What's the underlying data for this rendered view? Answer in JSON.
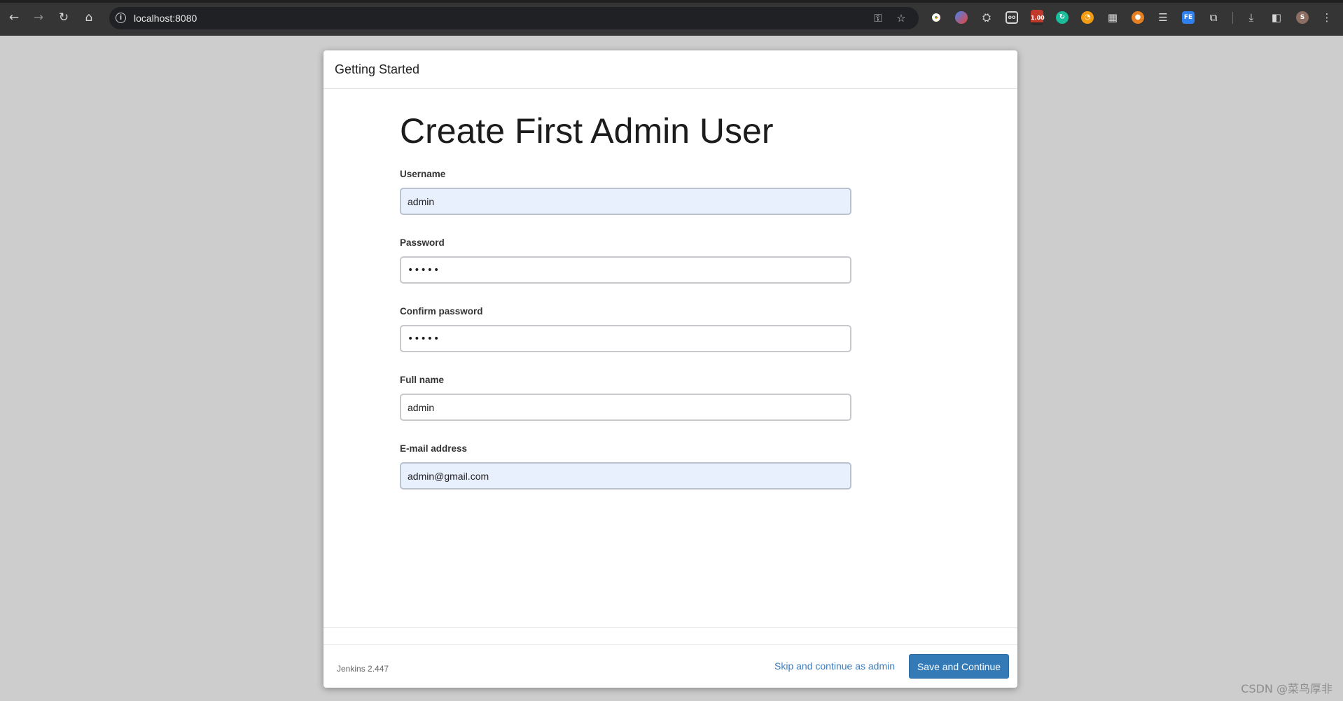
{
  "browser": {
    "url": "localhost:8080",
    "extension_badge": "1.00",
    "profile_initial": "S",
    "colors": {
      "toolbar": "#353535",
      "omnibox": "#202124"
    }
  },
  "dialog": {
    "header_title": "Getting Started",
    "heading": "Create First Admin User",
    "fields": [
      {
        "label": "Username",
        "value": "admin",
        "type": "text",
        "autofilled": true
      },
      {
        "label": "Password",
        "value": "•••••",
        "type": "password",
        "autofilled": false
      },
      {
        "label": "Confirm password",
        "value": "•••••",
        "type": "password",
        "autofilled": false
      },
      {
        "label": "Full name",
        "value": "admin",
        "type": "text",
        "autofilled": false
      },
      {
        "label": "E-mail address",
        "value": "admin@gmail.com",
        "type": "text",
        "autofilled": true
      }
    ],
    "footer": {
      "version": "Jenkins 2.447",
      "skip_label": "Skip and continue as admin",
      "save_label": "Save and Continue"
    },
    "colors": {
      "primary_button": "#337ab7",
      "link": "#3a7bbf",
      "autofill_background": "#e8f0fe"
    }
  },
  "watermark": "CSDN @菜鸟厚非"
}
